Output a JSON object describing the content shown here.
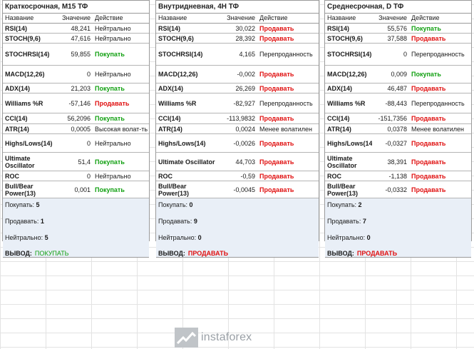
{
  "header": {
    "name": "Название",
    "value": "Значение",
    "action": "Действие"
  },
  "labels": {
    "buy": "Покупать:",
    "sell": "Продавать:",
    "neutral": "Нейтрально:",
    "verdict": "ВЫВОД:"
  },
  "panels": [
    {
      "title": "Краткосрочная, M15 ТФ",
      "rows": [
        {
          "name": "RSI(14)",
          "value": "48,241",
          "action": "Нейтрально",
          "type": "neutral"
        },
        {
          "name": "STOCH(9,6)",
          "value": "47,616",
          "action": "Нейтрально",
          "type": "neutral"
        },
        {
          "name": "STOCHRSI(14)",
          "value": "59,855",
          "action": "Покупать",
          "type": "buy"
        },
        {
          "name": "MACD(12,26)",
          "value": "0",
          "action": "Нейтрально",
          "type": "neutral"
        },
        {
          "name": "ADX(14)",
          "value": "21,203",
          "action": "Покупать",
          "type": "buy"
        },
        {
          "name": "Williams %R",
          "value": "-57,146",
          "action": "Продавать",
          "type": "sell"
        },
        {
          "name": "CCI(14)",
          "value": "56,2096",
          "action": "Покупать",
          "type": "buy"
        },
        {
          "name": "ATR(14)",
          "value": "0,0005",
          "action": "Высокая волат-ть",
          "type": "neutral"
        },
        {
          "name": "Highs/Lows(14)",
          "value": "0",
          "action": "Нейтрально",
          "type": "neutral"
        },
        {
          "name": "Ultimate Oscillator",
          "value": "51,4",
          "action": "Покупать",
          "type": "buy"
        },
        {
          "name": "ROC",
          "value": "0",
          "action": "Нейтрально",
          "type": "neutral"
        },
        {
          "name": "Bull/Bear Power(13)",
          "value": "0,001",
          "action": "Покупать",
          "type": "buy"
        }
      ],
      "summary": {
        "buy": "5",
        "sell": "1",
        "neutral": "5",
        "verdict": "ПОКУПАТЬ",
        "verdict_type": "buy"
      }
    },
    {
      "title": "Внутридневная, 4H ТФ",
      "rows": [
        {
          "name": "RSI(14)",
          "value": "30,022",
          "action": "Продавать",
          "type": "sell"
        },
        {
          "name": "STOCH(9,6)",
          "value": "28,392",
          "action": "Продавать",
          "type": "sell"
        },
        {
          "name": "STOCHRSI(14)",
          "value": "4,165",
          "action": "Перепроданность",
          "type": "neutral"
        },
        {
          "name": "MACD(12,26)",
          "value": "-0,002",
          "action": "Продавать",
          "type": "sell"
        },
        {
          "name": "ADX(14)",
          "value": "26,269",
          "action": "Продавать",
          "type": "sell"
        },
        {
          "name": "Williams %R",
          "value": "-82,927",
          "action": "Перепроданность",
          "type": "neutral"
        },
        {
          "name": "CCI(14)",
          "value": "-113,9832",
          "action": "Продавать",
          "type": "sell"
        },
        {
          "name": "ATR(14)",
          "value": "0,0024",
          "action": "Менее волатилен",
          "type": "neutral"
        },
        {
          "name": "Highs/Lows(14)",
          "value": "-0,0026",
          "action": "Продавать",
          "type": "sell"
        },
        {
          "name": "Ultimate Oscillator",
          "value": "44,703",
          "action": "Продавать",
          "type": "sell"
        },
        {
          "name": "ROC",
          "value": "-0,59",
          "action": "Продавать",
          "type": "sell"
        },
        {
          "name": "Bull/Bear Power(13)",
          "value": "-0,0045",
          "action": "Продавать",
          "type": "sell"
        }
      ],
      "summary": {
        "buy": "0",
        "sell": "9",
        "neutral": "0",
        "verdict": "ПРОДАВАТЬ",
        "verdict_type": "sell"
      }
    },
    {
      "title": "Среднесрочная, D ТФ",
      "rows": [
        {
          "name": "RSI(14)",
          "value": "55,576",
          "action": "Покупать",
          "type": "buy"
        },
        {
          "name": "STOCH(9,6)",
          "value": "37,588",
          "action": "Продавать",
          "type": "sell"
        },
        {
          "name": "STOCHRSI(14)",
          "value": "0",
          "action": "Перепроданность",
          "type": "neutral"
        },
        {
          "name": "MACD(12,26)",
          "value": "0,009",
          "action": "Покупать",
          "type": "buy"
        },
        {
          "name": "ADX(14)",
          "value": "46,487",
          "action": "Продавать",
          "type": "sell"
        },
        {
          "name": "Williams %R",
          "value": "-88,443",
          "action": "Перепроданность",
          "type": "neutral"
        },
        {
          "name": "CCI(14)",
          "value": "-151,7356",
          "action": "Продавать",
          "type": "sell"
        },
        {
          "name": "ATR(14)",
          "value": "0,0378",
          "action": "Менее волатилен",
          "type": "neutral"
        },
        {
          "name": "Highs/Lows(14)",
          "value": "-0,0327",
          "action": "Продавать",
          "type": "sell"
        },
        {
          "name": "Ultimate Oscillator",
          "value": "38,391",
          "action": "Продавать",
          "type": "sell"
        },
        {
          "name": "ROC",
          "value": "-1,138",
          "action": "Продавать",
          "type": "sell"
        },
        {
          "name": "Bull/Bear Power(13)",
          "value": "-0,0332",
          "action": "Продавать",
          "type": "sell"
        }
      ],
      "summary": {
        "buy": "2",
        "sell": "7",
        "neutral": "0",
        "verdict": "ПРОДАВАТЬ",
        "verdict_type": "sell"
      }
    }
  ],
  "watermark": {
    "text": "instaforex",
    "icon": "instaforex-logo-icon"
  },
  "colors": {
    "buy": "#12a012",
    "sell": "#e01010",
    "summary_bg": "#e9eff7"
  }
}
